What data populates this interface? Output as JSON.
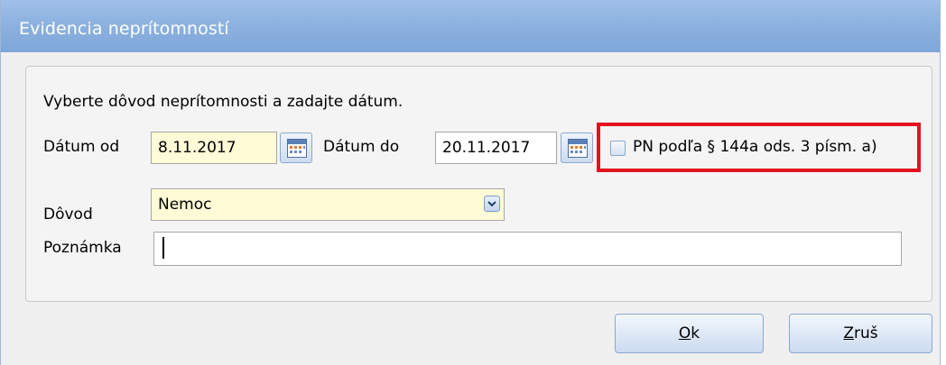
{
  "window": {
    "title": "Evidencia neprítomností"
  },
  "instruction": "Vyberte dôvod neprítomnosti a zadajte dátum.",
  "date_from": {
    "label": "Dátum od",
    "value": "8.11.2017"
  },
  "date_to": {
    "label": "Dátum do",
    "value": "20.11.2017"
  },
  "pn_checkbox": {
    "label": "PN podľa § 144a ods. 3 písm. a)",
    "checked": false
  },
  "reason": {
    "label": "Dôvod",
    "value": "Nemoc"
  },
  "note": {
    "label": "Poznámka",
    "value": ""
  },
  "buttons": {
    "ok": {
      "mnemonic": "O",
      "rest": "k"
    },
    "cancel": {
      "mnemonic": "Z",
      "rest": "ruš"
    }
  },
  "colors": {
    "highlight": "#e2131f",
    "title_bar": "#8db2e0",
    "input_yellow": "#fffbd6"
  }
}
